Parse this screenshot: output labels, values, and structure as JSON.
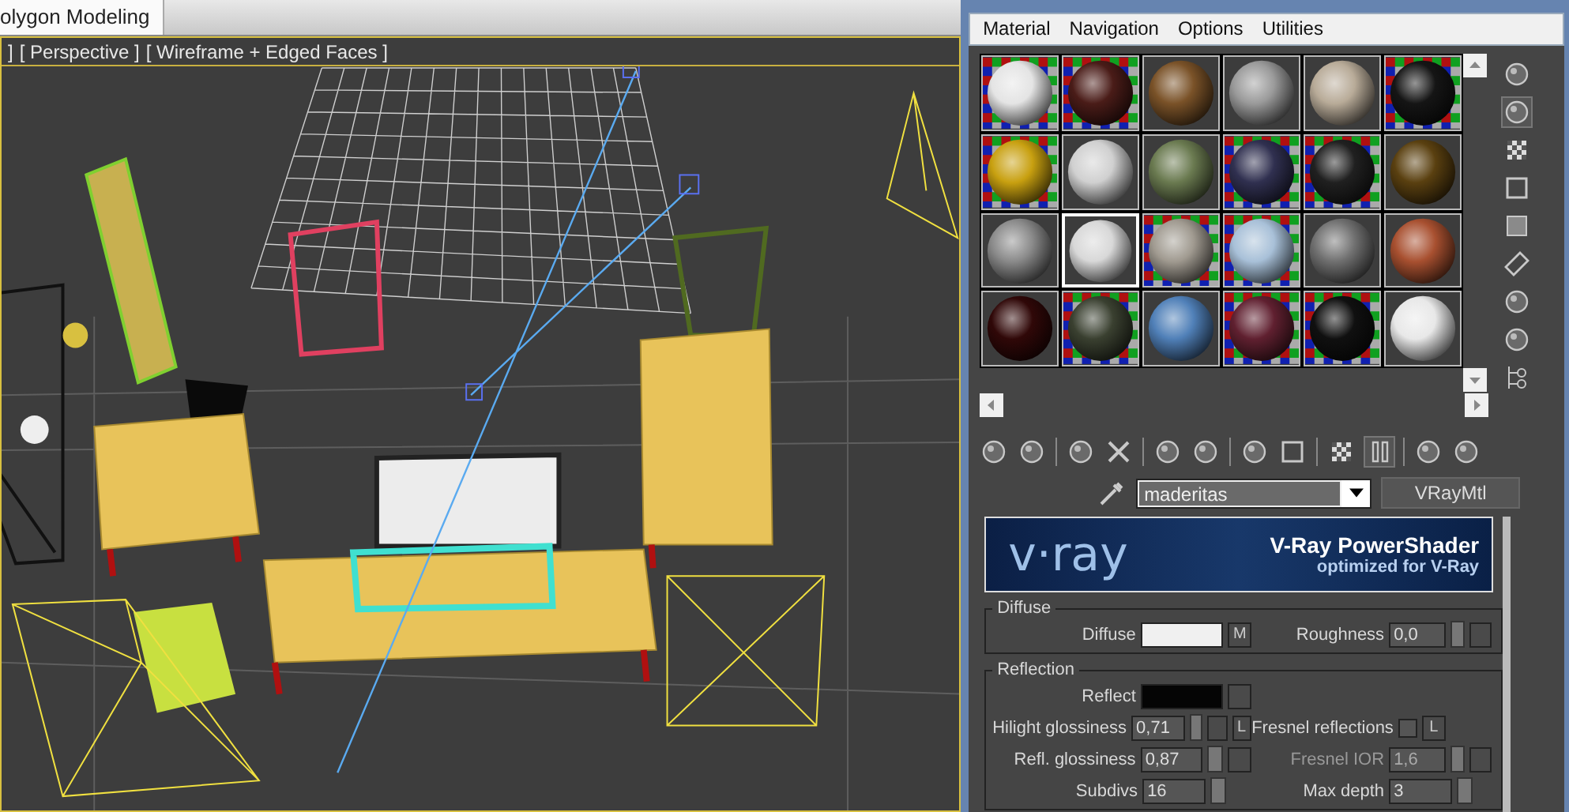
{
  "tab": {
    "label": "olygon Modeling"
  },
  "viewport": {
    "active": true,
    "labels": [
      "]",
      "[ Perspective ]",
      "[ Wireframe + Edged Faces ]"
    ]
  },
  "material_editor": {
    "menu": [
      "Material",
      "Navigation",
      "Options",
      "Utilities"
    ],
    "slots": [
      {
        "color": "#e4e4e4",
        "checker": true,
        "selected": false
      },
      {
        "color": "#4a1c18",
        "checker": true,
        "selected": false
      },
      {
        "color": "#7a5228",
        "checker": false,
        "selected": false
      },
      {
        "color": "#9a9a9a",
        "checker": false,
        "selected": false
      },
      {
        "color": "#b8ab98",
        "checker": false,
        "selected": false
      },
      {
        "color": "#151515",
        "checker": true,
        "selected": false
      },
      {
        "color": "#c8a010",
        "checker": true,
        "selected": false
      },
      {
        "color": "#d0d0d0",
        "checker": false,
        "selected": false
      },
      {
        "color": "#6a7a50",
        "checker": false,
        "selected": false
      },
      {
        "color": "#303050",
        "checker": true,
        "selected": false
      },
      {
        "color": "#202020",
        "checker": true,
        "selected": false
      },
      {
        "color": "#5a4010",
        "checker": false,
        "selected": false
      },
      {
        "color": "#8a8a8a",
        "checker": false,
        "selected": false
      },
      {
        "color": "#d8d8d8",
        "checker": false,
        "selected": true
      },
      {
        "color": "#a09a90",
        "checker": true,
        "selected": false
      },
      {
        "color": "#a8c0d8",
        "checker": true,
        "selected": false
      },
      {
        "color": "#707070",
        "checker": false,
        "selected": false
      },
      {
        "color": "#a85030",
        "checker": false,
        "selected": false
      },
      {
        "color": "#300808",
        "checker": false,
        "selected": false
      },
      {
        "color": "#3a4030",
        "checker": true,
        "selected": false
      },
      {
        "color": "#5080b8",
        "checker": false,
        "selected": false
      },
      {
        "color": "#602030",
        "checker": true,
        "selected": false
      },
      {
        "color": "#101010",
        "checker": true,
        "selected": false
      },
      {
        "color": "#e8e8e8",
        "checker": false,
        "selected": false
      }
    ],
    "name_field": {
      "value": "maderitas"
    },
    "type_button": "VRayMtl",
    "banner": {
      "logo": "v·ray",
      "title": "V-Ray PowerShader",
      "subtitle": "optimized for V-Ray"
    },
    "groups": [
      {
        "title": "Diffuse",
        "rows": [
          [
            {
              "kind": "color",
              "label": "Diffuse",
              "color": "#f0f0f0",
              "map_label": "M"
            },
            {
              "kind": "spinner",
              "label": "Roughness",
              "value": "0,0",
              "map_button": true,
              "disabled": false
            }
          ]
        ]
      },
      {
        "title": "Reflection",
        "rows": [
          [
            {
              "kind": "color",
              "label": "Reflect",
              "color": "#050505",
              "map_button": true
            }
          ],
          [
            {
              "kind": "spinner",
              "label": "Hilight glossiness",
              "value": "0,71",
              "map_button": true,
              "lock": "L",
              "disabled": false
            },
            {
              "kind": "checkbox",
              "label": "Fresnel reflections",
              "checked": false,
              "lock": "L"
            }
          ],
          [
            {
              "kind": "spinner",
              "label": "Refl. glossiness",
              "value": "0,87",
              "map_button": true,
              "disabled": false
            },
            {
              "kind": "spinner",
              "label": "Fresnel IOR",
              "value": "1,6",
              "map_button": true,
              "disabled": true
            }
          ],
          [
            {
              "kind": "spinner",
              "label": "Subdivs",
              "value": "16",
              "map_button": false,
              "disabled": false
            },
            {
              "kind": "spinner",
              "label": "Max depth",
              "value": "3",
              "map_button": false,
              "disabled": false
            }
          ]
        ]
      }
    ]
  }
}
